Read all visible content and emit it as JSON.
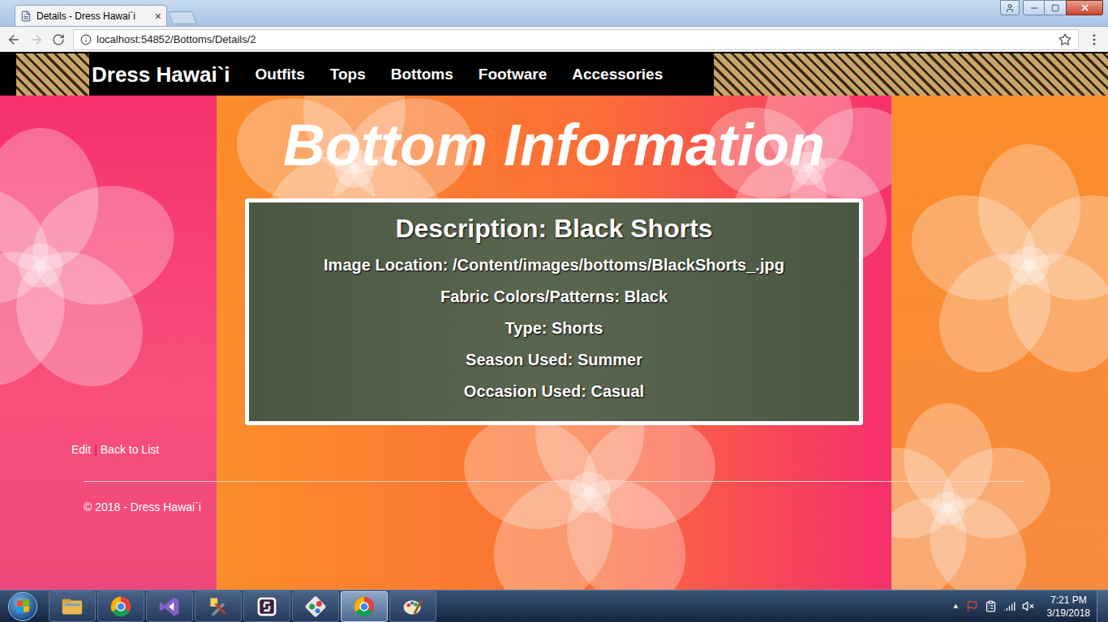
{
  "window": {
    "title": "Details - Dress Hawai`i",
    "close_glyph": "×"
  },
  "toolbar": {
    "url": "localhost:54852/Bottoms/Details/2",
    "back_disabled": false,
    "forward_disabled": true,
    "bookmarked": false
  },
  "navbar": {
    "brand": "Dress Hawai`i",
    "links": [
      "Outfits",
      "Tops",
      "Bottoms",
      "Footware",
      "Accessories"
    ]
  },
  "page": {
    "heading": "Bottom Information",
    "details": {
      "title": "Description: Black Shorts",
      "fields": [
        "Image Location: /Content/images/bottoms/BlackShorts_.jpg",
        "Fabric Colors/Patterns: Black",
        "Type: Shorts",
        "Season Used: Summer",
        "Occasion Used: Casual"
      ]
    },
    "actions": {
      "edit": "Edit",
      "separator": "|",
      "back": "Back to List"
    },
    "footer": "© 2018 - Dress Hawai`i"
  },
  "taskbar": {
    "apps": [
      {
        "kind": "explorer",
        "selected": false
      },
      {
        "kind": "chrome",
        "selected": false
      },
      {
        "kind": "studio",
        "selected": false
      },
      {
        "kind": "tools",
        "selected": false
      },
      {
        "kind": "slack",
        "selected": false
      },
      {
        "kind": "git",
        "selected": false
      },
      {
        "kind": "chrome",
        "selected": true
      },
      {
        "kind": "paint",
        "selected": false
      }
    ],
    "tray_arrow": "▲",
    "time": "7:21 PM",
    "date": "3/19/2018"
  }
}
